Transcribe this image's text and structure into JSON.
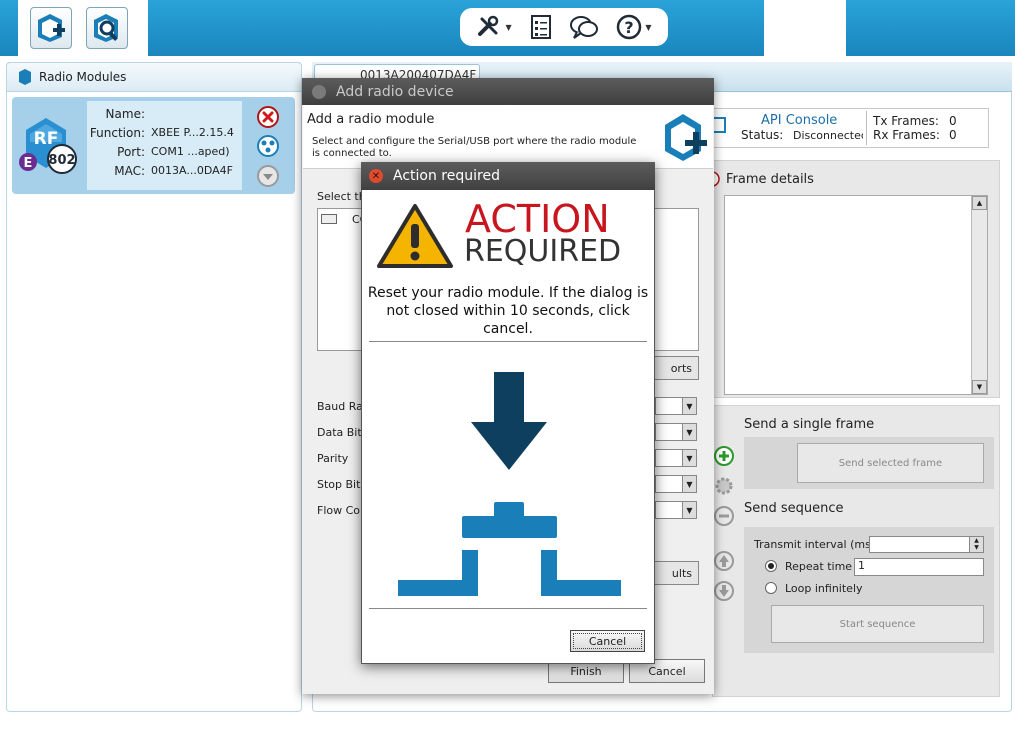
{
  "toolbar": {
    "add_device_icon": "add-radio-device-icon",
    "discover_icon": "discover-devices-icon",
    "tools_icon": "tools-icon",
    "xctu_config_icon": "configuration-list-icon",
    "chat_icon": "chat-icon",
    "help_icon": "help-icon"
  },
  "radio_modules": {
    "title": "Radio Modules",
    "module": {
      "badge_rf": "RF",
      "badge_e": "E",
      "badge_802": "802",
      "name_label": "Name:",
      "name_value": "",
      "function_label": "Function:",
      "function_value": "XBEE P...2.15.4",
      "port_label": "Port:",
      "port_value": "COM1 ...aped)",
      "mac_label": "MAC:",
      "mac_value": "0013A...0DA4F"
    }
  },
  "console": {
    "tab_mac": "0013A200407DA4F",
    "api_console": "API Console",
    "status_label": "Status:",
    "status_value": "Disconnected",
    "tx_frames": "Tx Frames:",
    "tx_value": "0",
    "rx_frames": "Rx Frames:",
    "rx_value": "0",
    "frame_details": "Frame details",
    "send_single": "Send a single frame",
    "send_selected": "Send selected frame",
    "send_sequence": "Send sequence",
    "transmit_interval": "Transmit interval (ms",
    "repeat_time": "Repeat time",
    "repeat_value": "1",
    "loop_infinitely": "Loop infinitely",
    "start_sequence": "Start sequence"
  },
  "add_dialog": {
    "title": "Add radio device",
    "header_title": "Add a radio module",
    "header_desc": "Select and configure the Serial/USB port where the radio module is connected to.",
    "select_label": "Select th",
    "port_item": "CO",
    "refresh": "orts",
    "baud": "Baud Ra",
    "data_bits": "Data Bits",
    "parity": "Parity",
    "stop_bits": "Stop Bits",
    "flow": "Flow Con",
    "defaults": "ults",
    "finish": "Finish",
    "cancel": "Cancel"
  },
  "action_dialog": {
    "title": "Action required",
    "action_word": "ACTION",
    "required_word": "REQUIRED",
    "message": "Reset your radio module. If the dialog is not closed within 10 seconds, click cancel.",
    "cancel": "Cancel"
  },
  "colors": {
    "accent_blue": "#1a86bd",
    "action_red": "#c8161e",
    "arrow_navy": "#0e3f5e",
    "device_blue": "#1a7fb8"
  }
}
